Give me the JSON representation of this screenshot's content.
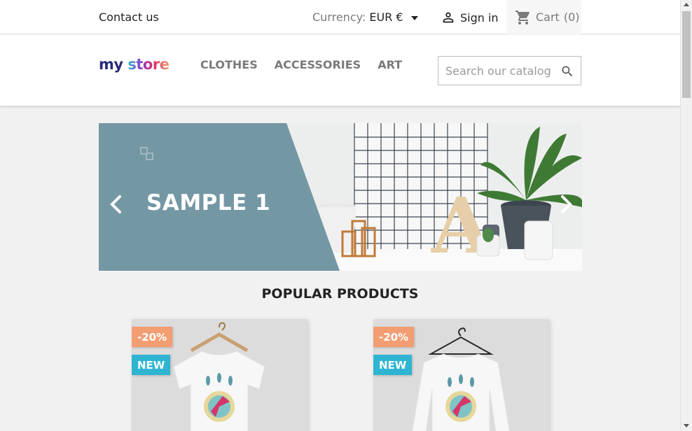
{
  "topnav": {
    "contact_label": "Contact us",
    "currency_label": "Currency:",
    "currency_value": "EUR €",
    "signin_label": "Sign in",
    "cart_label": "Cart",
    "cart_count": "(0)"
  },
  "header": {
    "logo_text_1": "my",
    "logo_text_2": "store",
    "menu": [
      "CLOTHES",
      "ACCESSORIES",
      "ART"
    ],
    "search_placeholder": "Search our catalog"
  },
  "carousel": {
    "slide_title": "SAMPLE 1"
  },
  "section": {
    "title": "POPULAR PRODUCTS"
  },
  "products": [
    {
      "discount": "-20%",
      "flag": "NEW"
    },
    {
      "discount": "-20%",
      "flag": "NEW"
    }
  ],
  "colors": {
    "accent": "#2fb5d2",
    "discount": "#f39d72",
    "slide_panel": "#7497a4"
  }
}
